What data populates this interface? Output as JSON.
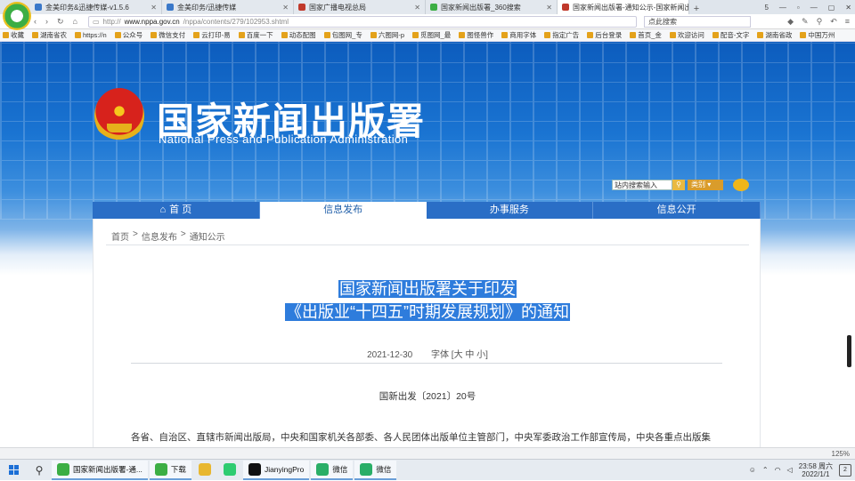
{
  "browser": {
    "tabs": [
      {
        "label": "金美印务&迅捷传媒-v1.5.6",
        "color": "#3a78c9"
      },
      {
        "label": "金美印务/迅捷传媒",
        "color": "#3a78c9"
      },
      {
        "label": "国家广播电视总局",
        "color": "#c0392b"
      },
      {
        "label": "国家新闻出版署_360搜索",
        "color": "#3cae44"
      },
      {
        "label": "国家新闻出版署-通知公示-国家新闻出",
        "color": "#c0392b",
        "active": true
      }
    ],
    "newtab": "+",
    "window_controls": [
      "5",
      "—",
      "▫",
      "—",
      "▢",
      "✕"
    ],
    "nav_buttons": [
      "‹",
      "›",
      "↻",
      "⌂"
    ],
    "address_prefix": "http://",
    "address_host": "www.nppa.gov.cn",
    "address_path": "/nppa/contents/279/102953.shtml",
    "search_placeholder": "点此搜索",
    "favorites": [
      "收藏",
      "湖南省农",
      "https://n",
      "公众号",
      "微信支付",
      "云打印-易",
      "百度一下",
      "动态配图",
      "包图网_专",
      "六图网-p",
      "觅图网_最",
      "图怪兽作",
      "商用字体",
      "指定广告",
      "后台登录",
      "首页_金",
      "欢迎访问",
      "配音-文字",
      "湖南省政",
      "中国万州"
    ]
  },
  "site": {
    "name_cn": "国家新闻出版署",
    "name_en": "National Press and Publication Administration",
    "search_value": "站内搜索输入",
    "search_category": "类别",
    "nav": [
      {
        "label": "首 页",
        "icon": "home-icon"
      },
      {
        "label": "信息发布",
        "active": true
      },
      {
        "label": "办事服务"
      },
      {
        "label": "信息公开"
      }
    ]
  },
  "breadcrumb": [
    "首页",
    ">",
    "信息发布",
    ">",
    "通知公示"
  ],
  "article": {
    "title_line1": "国家新闻出版署关于印发",
    "title_line2": "《出版业“十四五”时期发展规划》的通知",
    "date": "2021-12-30",
    "font_size_label": "字体 [大 中 小]",
    "doc_number": "国新出发〔2021〕20号",
    "first_paragraph": "各省、自治区、直辖市新闻出版局，中央和国家机关各部委、各人民团体出版单位主管部门，中央军委政治工作部宣传局，中央各重点出版集"
  },
  "status_bar": {
    "zoom": "125%"
  },
  "taskbar": {
    "items": [
      {
        "label": "国家新闻出版署-通...",
        "color": "#3cae44",
        "open": true
      },
      {
        "label": "下载",
        "color": "#3cae44",
        "open": true
      },
      {
        "label": "",
        "color": "#e8b730",
        "open": false
      },
      {
        "label": "",
        "color": "#2ecc71",
        "open": false
      },
      {
        "label": "JianyingPro",
        "color": "#111111",
        "open": true
      },
      {
        "label": "微信",
        "color": "#2aae67",
        "open": true
      },
      {
        "label": "微信",
        "color": "#2aae67",
        "open": true
      }
    ],
    "time": "23:58 周六",
    "date": "2022/1/1",
    "notifications": "2"
  }
}
